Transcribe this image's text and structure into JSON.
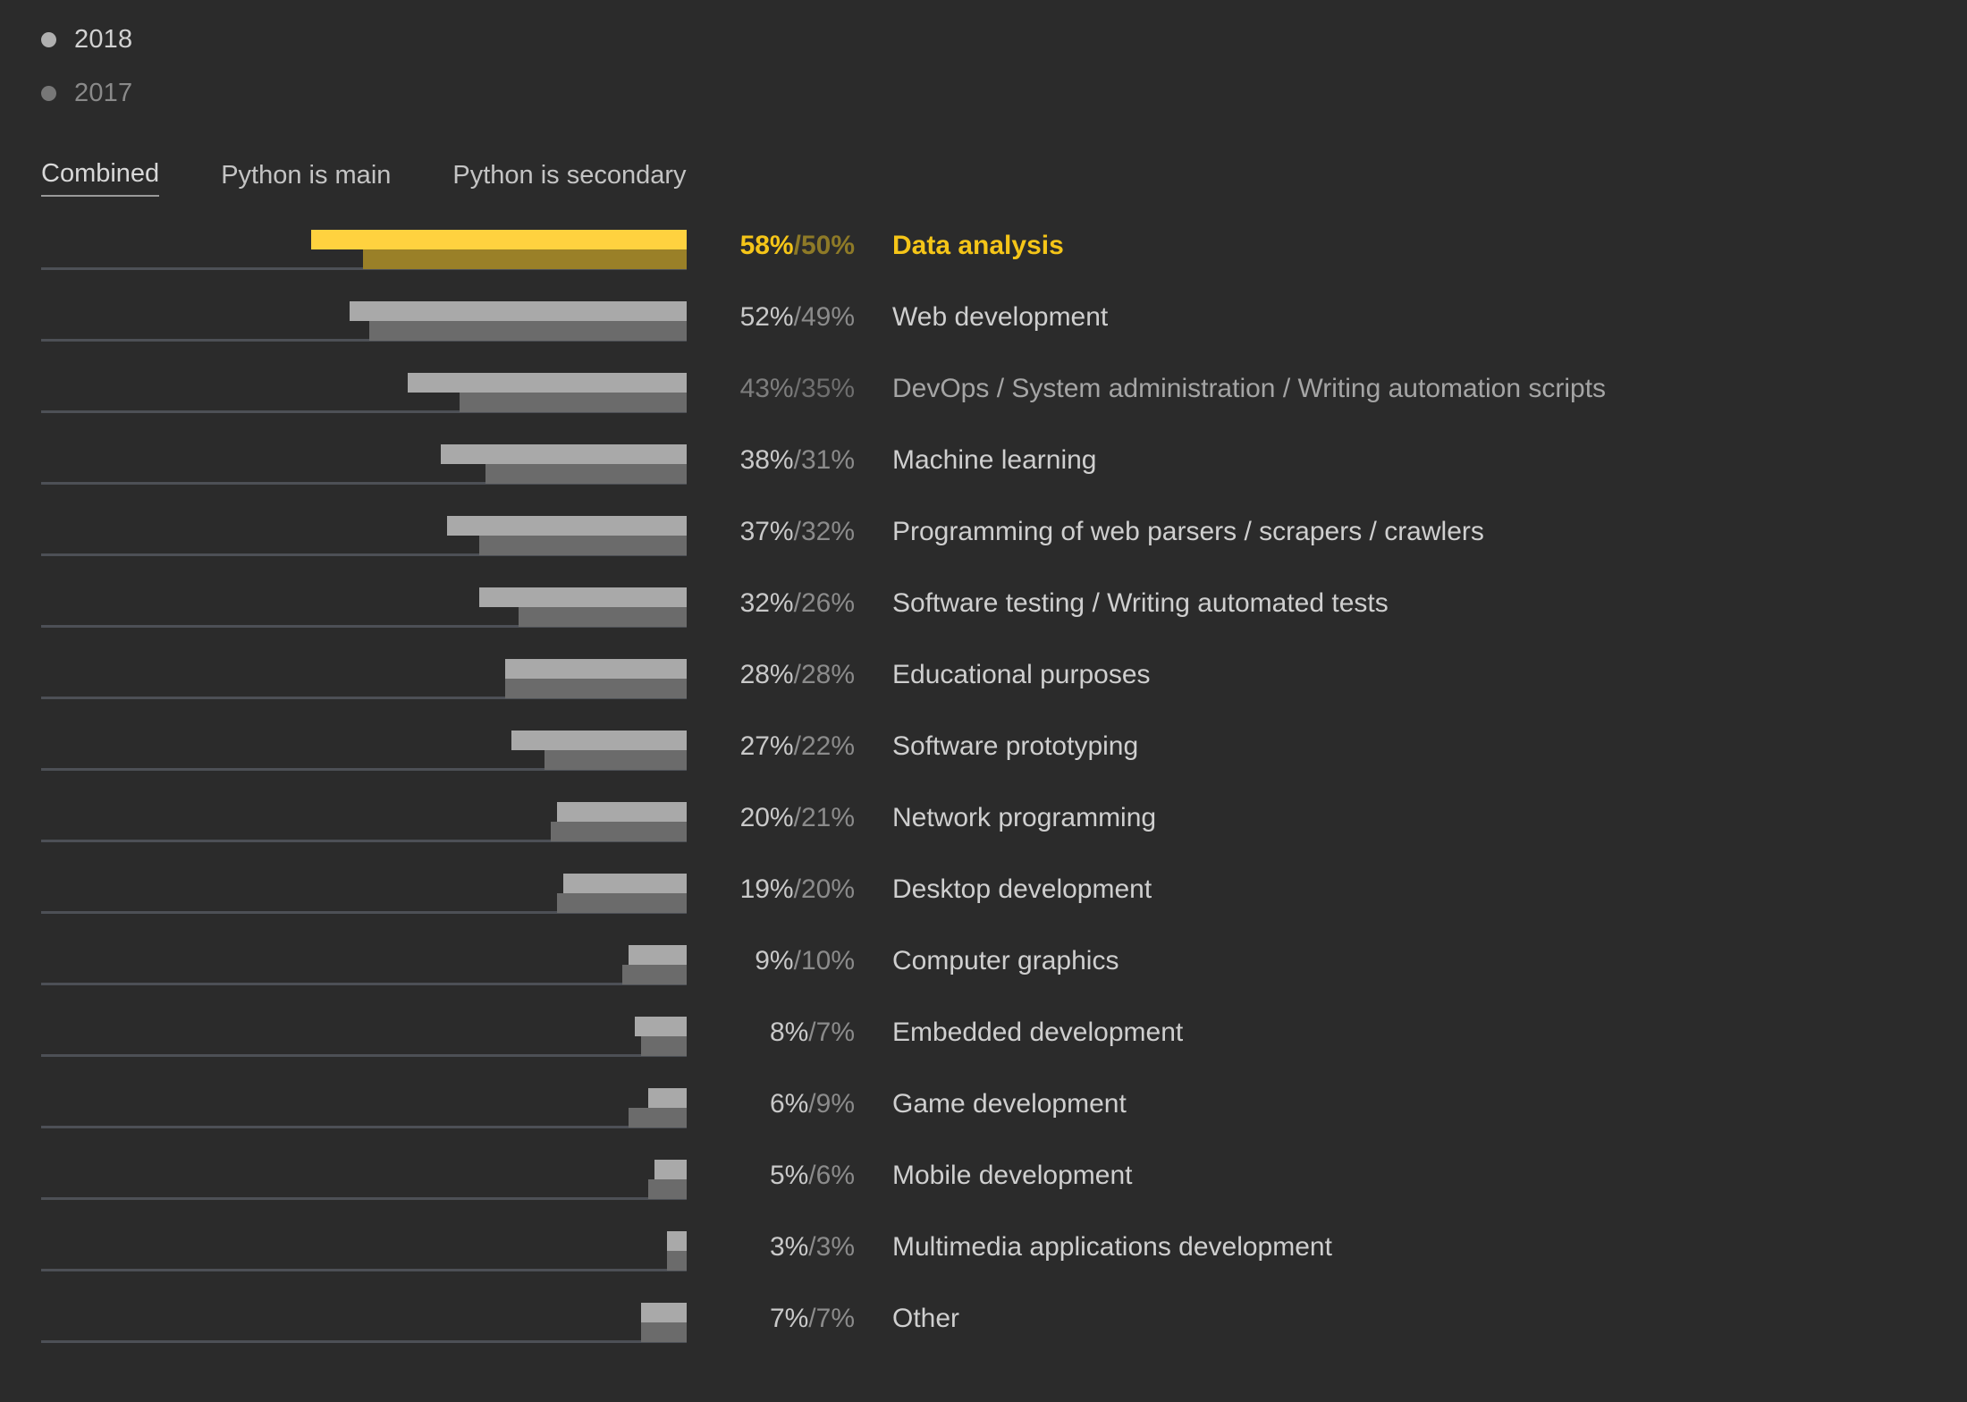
{
  "legend": {
    "items": [
      {
        "year": "2018",
        "dot_color": "#b0b0b0"
      },
      {
        "year": "2017",
        "dot_color": "#777777"
      }
    ]
  },
  "tabs": [
    {
      "label": "Combined",
      "active": true
    },
    {
      "label": "Python is main",
      "active": false
    },
    {
      "label": "Python is secondary",
      "active": false
    }
  ],
  "chart_data": {
    "type": "bar",
    "title": "",
    "xlabel": "",
    "ylabel": "",
    "orientation": "horizontal",
    "axis_max": 100,
    "grid": false,
    "legend_position": "top-left",
    "series": [
      {
        "name": "2018",
        "color": "#a9a9a9",
        "highlight_color": "#ffd23f",
        "values": [
          58,
          52,
          43,
          38,
          37,
          32,
          28,
          27,
          20,
          19,
          9,
          8,
          6,
          5,
          3,
          7
        ]
      },
      {
        "name": "2017",
        "color": "#6b6b6b",
        "highlight_color": "#9a8028",
        "values": [
          50,
          49,
          35,
          31,
          32,
          26,
          28,
          22,
          21,
          20,
          10,
          7,
          9,
          6,
          3,
          7
        ]
      }
    ],
    "categories": [
      "Data analysis",
      "Web development",
      "DevOps / System administration / Writing automation scripts",
      "Machine learning",
      "Programming of web parsers / scrapers / crawlers",
      "Software testing / Writing automated tests",
      "Educational purposes",
      "Software prototyping",
      "Network programming",
      "Desktop development",
      "Computer graphics",
      "Embedded development",
      "Game development",
      "Mobile development",
      "Multimedia applications development",
      "Other"
    ],
    "rows": [
      {
        "category": "Data analysis",
        "v2018": 58,
        "v2017": 50,
        "pct_label_2018": "58%",
        "pct_label_2017": "50%",
        "state": "highlight"
      },
      {
        "category": "Web development",
        "v2018": 52,
        "v2017": 49,
        "pct_label_2018": "52%",
        "pct_label_2017": "49%",
        "state": "normal"
      },
      {
        "category": "DevOps / System administration / Writing automation scripts",
        "v2018": 43,
        "v2017": 35,
        "pct_label_2018": "43%",
        "pct_label_2017": "35%",
        "state": "dim"
      },
      {
        "category": "Machine learning",
        "v2018": 38,
        "v2017": 31,
        "pct_label_2018": "38%",
        "pct_label_2017": "31%",
        "state": "normal"
      },
      {
        "category": "Programming of web parsers / scrapers / crawlers",
        "v2018": 37,
        "v2017": 32,
        "pct_label_2018": "37%",
        "pct_label_2017": "32%",
        "state": "normal"
      },
      {
        "category": "Software testing / Writing automated tests",
        "v2018": 32,
        "v2017": 26,
        "pct_label_2018": "32%",
        "pct_label_2017": "26%",
        "state": "normal"
      },
      {
        "category": "Educational purposes",
        "v2018": 28,
        "v2017": 28,
        "pct_label_2018": "28%",
        "pct_label_2017": "28%",
        "state": "normal"
      },
      {
        "category": "Software prototyping",
        "v2018": 27,
        "v2017": 22,
        "pct_label_2018": "27%",
        "pct_label_2017": "22%",
        "state": "normal"
      },
      {
        "category": "Network programming",
        "v2018": 20,
        "v2017": 21,
        "pct_label_2018": "20%",
        "pct_label_2017": "21%",
        "state": "normal"
      },
      {
        "category": "Desktop development",
        "v2018": 19,
        "v2017": 20,
        "pct_label_2018": "19%",
        "pct_label_2017": "20%",
        "state": "normal"
      },
      {
        "category": "Computer graphics",
        "v2018": 9,
        "v2017": 10,
        "pct_label_2018": "9%",
        "pct_label_2017": "10%",
        "state": "normal"
      },
      {
        "category": "Embedded development",
        "v2018": 8,
        "v2017": 7,
        "pct_label_2018": "8%",
        "pct_label_2017": "7%",
        "state": "normal"
      },
      {
        "category": "Game development",
        "v2018": 6,
        "v2017": 9,
        "pct_label_2018": "6%",
        "pct_label_2017": "9%",
        "state": "normal"
      },
      {
        "category": "Mobile development",
        "v2018": 5,
        "v2017": 6,
        "pct_label_2018": "5%",
        "pct_label_2017": "6%",
        "state": "normal"
      },
      {
        "category": "Multimedia applications development",
        "v2018": 3,
        "v2017": 3,
        "pct_label_2018": "3%",
        "pct_label_2017": "3%",
        "state": "normal"
      },
      {
        "category": "Other",
        "v2018": 7,
        "v2017": 7,
        "pct_label_2018": "7%",
        "pct_label_2017": "7%",
        "state": "normal"
      }
    ]
  },
  "colors": {
    "background": "#2b2b2b",
    "accent": "#ffd23f",
    "accent_dark": "#9a8028",
    "bar_2018": "#a9a9a9",
    "bar_2017": "#6b6b6b",
    "track": "#4d5056"
  }
}
